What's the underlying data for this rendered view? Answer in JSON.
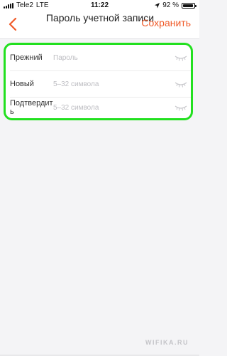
{
  "status_bar": {
    "carrier": "Tele2",
    "network": "LTE",
    "time": "11:22",
    "battery_percent": "92 %",
    "battery_level": 0.92
  },
  "nav": {
    "title": "Пароль учетной записи",
    "save_label": "Сохранить",
    "accent_color": "#f05a28",
    "back_icon": "chevron-left-icon"
  },
  "form": {
    "highlight_color": "#22e01f",
    "rows": [
      {
        "label": "Прежний",
        "placeholder": "Пароль",
        "icon": "eye-closed-icon"
      },
      {
        "label": "Новый",
        "placeholder": "5–32 символа",
        "icon": "eye-closed-icon"
      },
      {
        "label": "Подтвердить",
        "placeholder": "5–32 символа",
        "icon": "eye-closed-icon"
      }
    ]
  },
  "watermark": "WIFIKA.RU"
}
